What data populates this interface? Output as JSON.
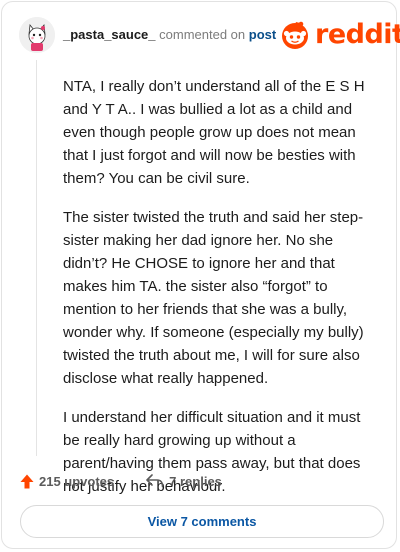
{
  "comment": {
    "username": "_pasta_sauce_",
    "action_text": "commented on",
    "post_link_text": "post",
    "avatar_icon": "cat-avatar-icon",
    "paragraphs": [
      "NTA, I really don’t understand all of the E S H and Y T A.. I was bullied a lot as a child and even though people grow up does not mean that I just forgot and will now be besties with them? You can be civil sure.",
      "The sister twisted the truth and said her step-sister making her dad ignore her. No she didn’t? He CHOSE to ignore her and that makes him TA. the sister also “forgot” to mention to her friends that she was a bully, wonder why. If someone (especially my bully) twisted the truth about me, I will for sure also disclose what really happened.",
      "I understand her difficult situation and it must be really hard growing up without a parent/having them pass away, but that does not justify her behaviour."
    ],
    "upvotes_text": "215 upvotes",
    "replies_text": "7 replies",
    "view_comments_label": "View 7 comments"
  },
  "brand": {
    "logo_text": "reddit",
    "logo_icon": "reddit-snoo-icon",
    "color": "#ff4500"
  },
  "colors": {
    "link": "#0b57a4",
    "upvote": "#ff4500"
  }
}
